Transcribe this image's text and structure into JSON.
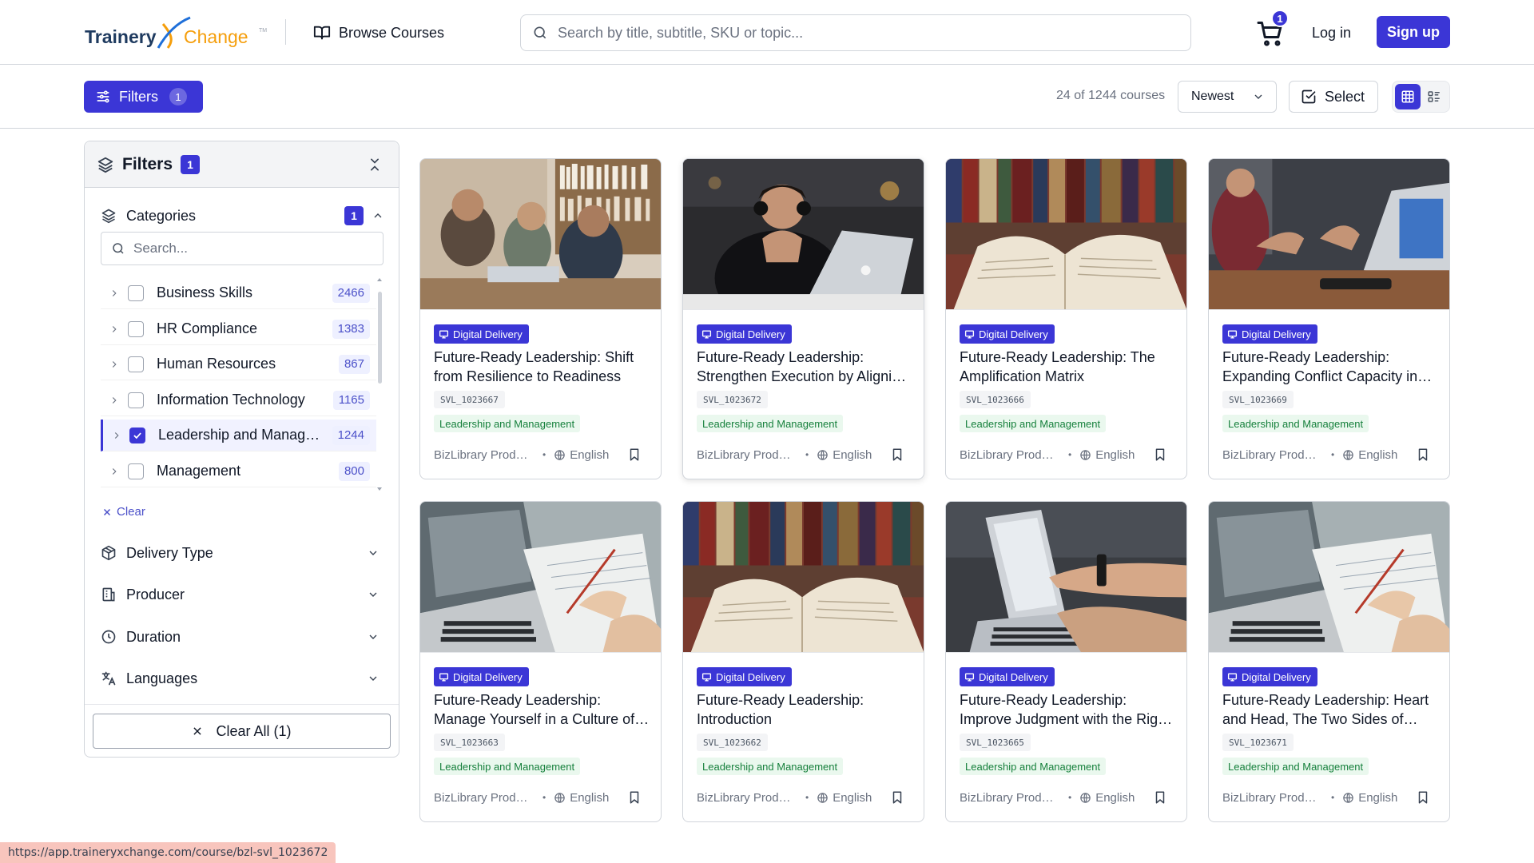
{
  "header": {
    "logo_left": "Trainery",
    "logo_right": "Change",
    "logo_tm": "TM",
    "browse_label": "Browse Courses",
    "search_placeholder": "Search by title, subtitle, SKU or topic...",
    "cart_count": "1",
    "login_label": "Log in",
    "signup_label": "Sign up"
  },
  "toolbar": {
    "filters_label": "Filters",
    "filters_count": "1",
    "result_text": "24 of 1244 courses",
    "sort_value": "Newest",
    "select_label": "Select"
  },
  "sidebar": {
    "title": "Filters",
    "count": "1",
    "categories_label": "Categories",
    "categories_count": "1",
    "search_placeholder": "Search...",
    "categories": [
      {
        "label": "Business Skills",
        "count": "2466",
        "checked": false
      },
      {
        "label": "HR Compliance",
        "count": "1383",
        "checked": false
      },
      {
        "label": "Human Resources",
        "count": "867",
        "checked": false
      },
      {
        "label": "Information Technology",
        "count": "1165",
        "checked": false
      },
      {
        "label": "Leadership and Management",
        "count": "1244",
        "checked": true
      },
      {
        "label": "Management",
        "count": "800",
        "checked": false
      }
    ],
    "clear_label": "Clear",
    "sections": [
      "Delivery Type",
      "Producer",
      "Duration",
      "Languages"
    ],
    "clear_all_label": "Clear All (1)"
  },
  "cards": [
    {
      "tag": "Digital Delivery",
      "title": "Future-Ready Leadership: Shift from Resilience to Readiness",
      "sku": "SVL_1023667",
      "category": "Leadership and Management",
      "producer": "BizLibrary Productions",
      "language": "English",
      "image": "library-team"
    },
    {
      "tag": "Digital Delivery",
      "title": "Future-Ready Leadership: Strengthen Execution by Aligning Priorities",
      "sku": "SVL_1023672",
      "category": "Leadership and Management",
      "producer": "BizLibrary Productions",
      "language": "English",
      "image": "man-laptop"
    },
    {
      "tag": "Digital Delivery",
      "title": "Future-Ready Leadership: The Amplification Matrix",
      "sku": "SVL_1023666",
      "category": "Leadership and Management",
      "producer": "BizLibrary Productions",
      "language": "English",
      "image": "open-book"
    },
    {
      "tag": "Digital Delivery",
      "title": "Future-Ready Leadership: Expanding Conflict Capacity in Teams",
      "sku": "SVL_1023669",
      "category": "Leadership and Management",
      "producer": "BizLibrary Productions",
      "language": "English",
      "image": "meeting-laptop"
    },
    {
      "tag": "Digital Delivery",
      "title": "Future-Ready Leadership: Manage Yourself in a Culture of Change",
      "sku": "SVL_1023663",
      "category": "Leadership and Management",
      "producer": "BizLibrary Productions",
      "language": "English",
      "image": "writing-laptop"
    },
    {
      "tag": "Digital Delivery",
      "title": "Future-Ready Leadership: Introduction",
      "sku": "SVL_1023662",
      "category": "Leadership and Management",
      "producer": "BizLibrary Productions",
      "language": "English",
      "image": "open-book"
    },
    {
      "tag": "Digital Delivery",
      "title": "Future-Ready Leadership: Improve Judgment with the Right Questions",
      "sku": "SVL_1023665",
      "category": "Leadership and Management",
      "producer": "BizLibrary Productions",
      "language": "English",
      "image": "pointing-laptop"
    },
    {
      "tag": "Digital Delivery",
      "title": "Future-Ready Leadership: Heart and Head, The Two Sides of Leadership",
      "sku": "SVL_1023671",
      "category": "Leadership and Management",
      "producer": "BizLibrary Productions",
      "language": "English",
      "image": "writing-laptop"
    }
  ],
  "status_url": "https://app.traineryxchange.com/course/bzl-svl_1023672",
  "colors": {
    "accent": "#3b36d6",
    "category_green": "#16803c",
    "category_green_bg": "#eaf8ee"
  }
}
